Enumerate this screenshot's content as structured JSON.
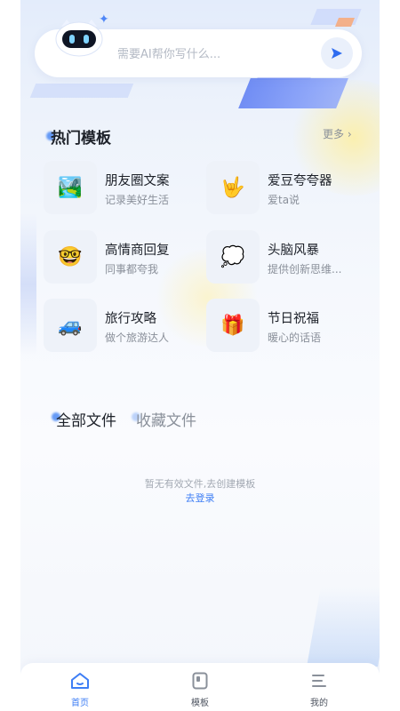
{
  "colors": {
    "accent": "#3e7ef5",
    "text_primary": "#1d2129",
    "text_secondary": "#8a909a"
  },
  "ask": {
    "placeholder": "需要AI帮你写什么...",
    "mascot_icon": "robot-mascot-icon",
    "send_icon": "send-icon"
  },
  "hot": {
    "title": "热门模板",
    "more": "更多 ›",
    "items": [
      {
        "name": "朋友圈文案",
        "desc": "记录美好生活",
        "icon": "🏞️"
      },
      {
        "name": "爱豆夸夸器",
        "desc": "爱ta说",
        "icon": "🤟"
      },
      {
        "name": "高情商回复",
        "desc": "同事都夸我",
        "icon": "🤓"
      },
      {
        "name": "头脑风暴",
        "desc": "提供创新思维...",
        "icon": "💭"
      },
      {
        "name": "旅行攻略",
        "desc": "做个旅游达人",
        "icon": "🚙"
      },
      {
        "name": "节日祝福",
        "desc": "暖心的话语",
        "icon": "🎁"
      }
    ]
  },
  "files": {
    "tabs": [
      "全部文件",
      "收藏文件"
    ],
    "active_tab": 0,
    "empty_text": "暂无有效文件,去创建模板",
    "login_link": "去登录"
  },
  "tabbar": {
    "items": [
      {
        "label": "首页",
        "icon": "home-icon",
        "active": true
      },
      {
        "label": "模板",
        "icon": "template-icon",
        "active": false
      },
      {
        "label": "我的",
        "icon": "menu-icon",
        "active": false
      }
    ]
  }
}
